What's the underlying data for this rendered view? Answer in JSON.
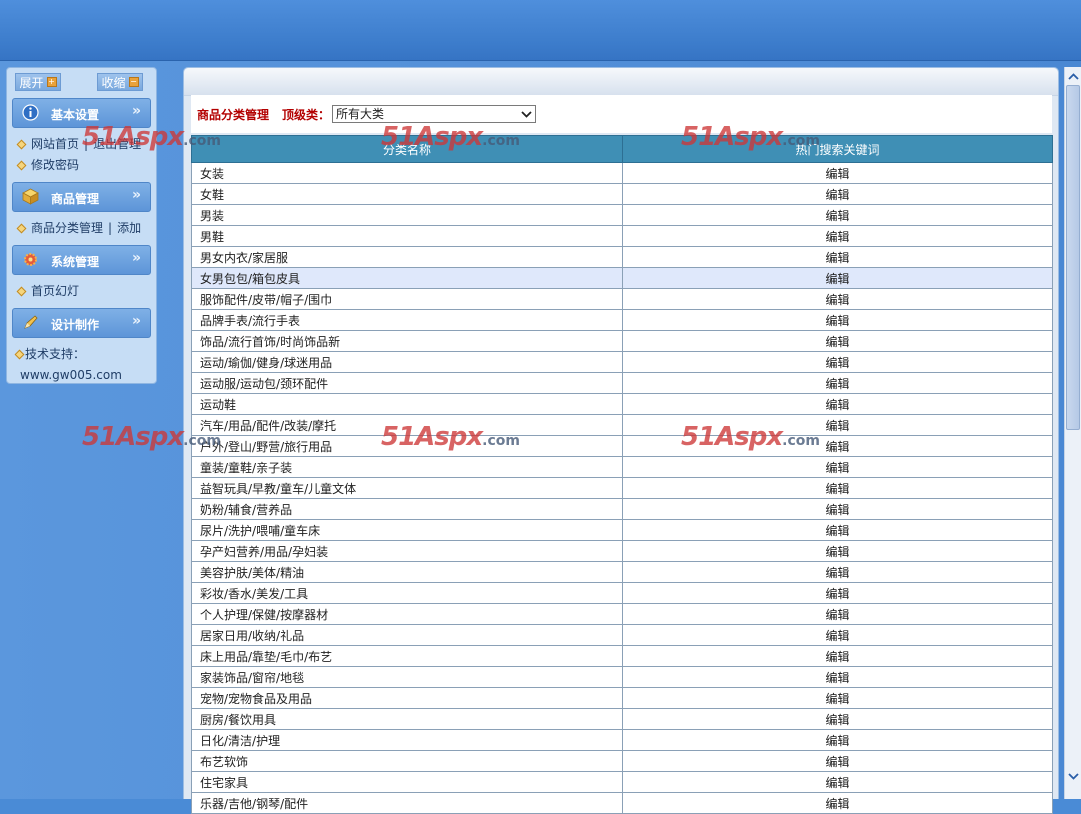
{
  "left_menu": {
    "expand_label": "展开",
    "collapse_label": "收缩",
    "sections": [
      {
        "title": "基本设置",
        "icon": "info-icon",
        "links": [
          [
            "网站首页",
            "退出管理"
          ],
          [
            "修改密码"
          ]
        ]
      },
      {
        "title": "商品管理",
        "icon": "box-icon",
        "links": [
          [
            "商品分类管理",
            "添加"
          ]
        ]
      },
      {
        "title": "系统管理",
        "icon": "gear-icon",
        "links": [
          [
            "首页幻灯"
          ]
        ]
      },
      {
        "title": "设计制作",
        "icon": "pencil-icon",
        "links": [
          [
            "技术支持："
          ],
          [
            "www.gw005.com"
          ]
        ]
      }
    ]
  },
  "main": {
    "page_title": "商品分类管理",
    "filter_label": "顶级类：",
    "filter_value": "所有大类",
    "columns": [
      "分类名称",
      "热门搜索关键词"
    ],
    "action_label": "编辑",
    "highlighted_row": 5,
    "rows": [
      "女装",
      "女鞋",
      "男装",
      "男鞋",
      "男女内衣/家居服",
      "女男包包/箱包皮具",
      "服饰配件/皮带/帽子/围巾",
      "品牌手表/流行手表",
      "饰品/流行首饰/时尚饰品新",
      "运动/瑜伽/健身/球迷用品",
      "运动服/运动包/颈环配件",
      "运动鞋",
      "汽车/用品/配件/改装/摩托",
      "户外/登山/野营/旅行用品",
      "童装/童鞋/亲子装",
      "益智玩具/早教/童车/儿童文体",
      "奶粉/辅食/营养品",
      "尿片/洗护/喂哺/童车床",
      "孕产妇营养/用品/孕妇装",
      "美容护肤/美体/精油",
      "彩妆/香水/美发/工具",
      "个人护理/保健/按摩器材",
      "居家日用/收纳/礼品",
      "床上用品/靠垫/毛巾/布艺",
      "家装饰品/窗帘/地毯",
      "宠物/宠物食品及用品",
      "厨房/餐饮用具",
      "日化/清洁/护理",
      "布艺软饰",
      "住宅家具",
      "乐器/吉他/钢琴/配件"
    ]
  },
  "watermark": {
    "main": "51Aspx",
    "suffix": ".com"
  },
  "colors": {
    "background_blue": "#4a8bd6",
    "title_red": "#b30000",
    "table_header": "#3f8fb5",
    "highlight_row": "#dfe8fb"
  }
}
